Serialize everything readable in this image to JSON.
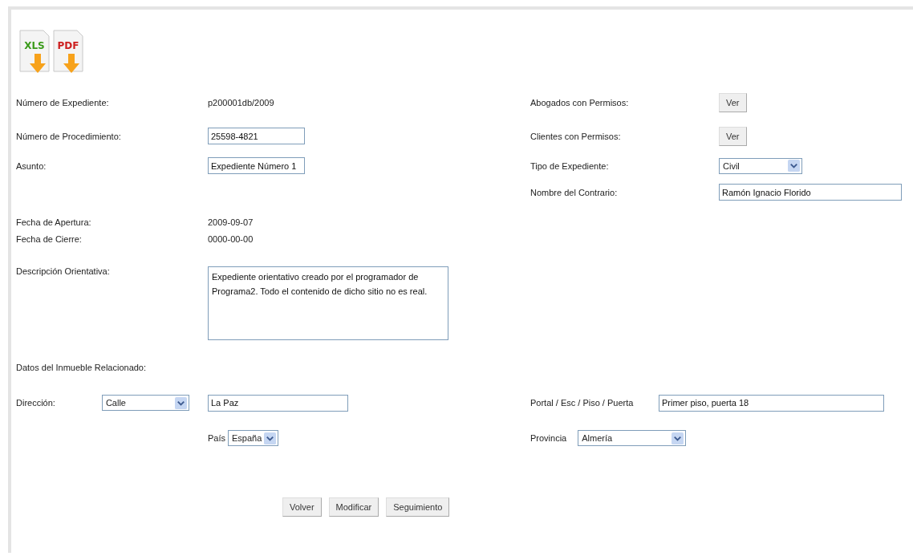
{
  "export_icons": [
    {
      "label": "XLS",
      "kind": "xls"
    },
    {
      "label": "PDF",
      "kind": "pdf"
    }
  ],
  "expediente": {
    "left": [
      {
        "kind": "static",
        "label": "Número de Expediente:",
        "value": "p200001db/2009"
      },
      {
        "kind": "input",
        "label": "Número de Procedimiento:",
        "value": "25598-4821"
      },
      {
        "kind": "input",
        "label": "Asunto:",
        "value": "Expediente Número 1"
      }
    ],
    "right": [
      {
        "kind": "button",
        "label": "Abogados con Permisos:",
        "value": "Ver"
      },
      {
        "kind": "button",
        "label": "Clientes con Permisos:",
        "value": "Ver"
      },
      {
        "kind": "select",
        "label": "Tipo de Expediente:",
        "value": "Civil"
      },
      {
        "kind": "input",
        "label": "Nombre del Contrario:",
        "value": "Ramón Ignacio Florido"
      }
    ]
  },
  "dates": [
    {
      "label": "Fecha de Apertura:",
      "value": "2009-09-07"
    },
    {
      "label": "Fecha de Cierre:",
      "value": "0000-00-00"
    }
  ],
  "description": {
    "label": "Descripción Orientativa:",
    "value": "Expediente orientativo creado por el programador de Programa2. Todo el contenido de dicho sitio no es real."
  },
  "inmueble": {
    "heading": "Datos del Inmueble Relacionado:",
    "direccion": {
      "label": "Dirección:",
      "via_type": "Calle",
      "street": "La Paz"
    },
    "portal": {
      "label": "Portal / Esc / Piso / Puerta",
      "value": "Primer piso, puerta 18"
    },
    "pais": {
      "label": "País",
      "value": "España"
    },
    "provincia": {
      "label": "Provincia",
      "value": "Almería"
    }
  },
  "buttons": [
    "Volver",
    "Modificar",
    "Seguimiento"
  ]
}
